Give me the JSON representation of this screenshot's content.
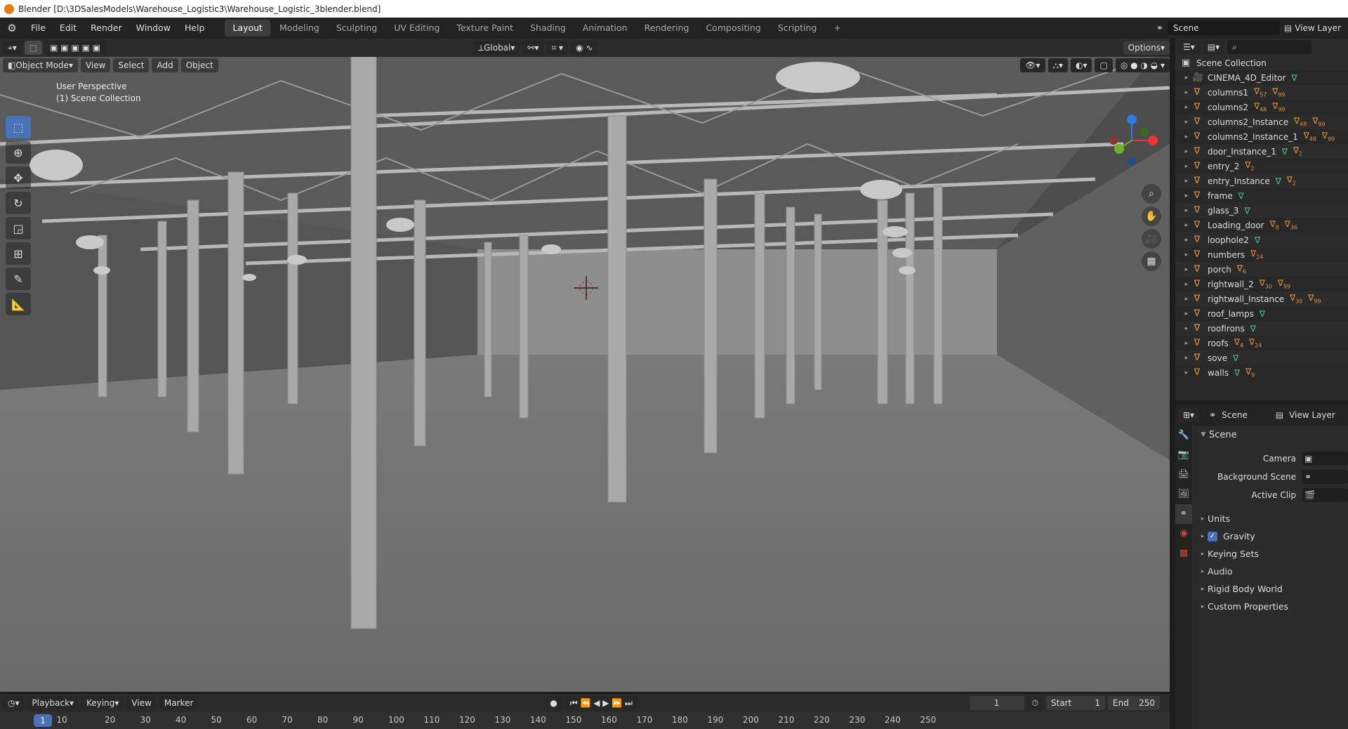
{
  "window": {
    "title": "Blender [D:\\3DSalesModels\\Warehouse_Logistic3\\Warehouse_Logistic_3blender.blend]"
  },
  "menu": [
    "File",
    "Edit",
    "Render",
    "Window",
    "Help"
  ],
  "workspaces": [
    {
      "label": "Layout",
      "active": true
    },
    {
      "label": "Modeling"
    },
    {
      "label": "Sculpting"
    },
    {
      "label": "UV Editing"
    },
    {
      "label": "Texture Paint"
    },
    {
      "label": "Shading"
    },
    {
      "label": "Animation"
    },
    {
      "label": "Rendering"
    },
    {
      "label": "Compositing"
    },
    {
      "label": "Scripting"
    }
  ],
  "top_right": {
    "scene": "Scene",
    "view_layer": "View Layer"
  },
  "viewport_header": {
    "mode": "Object Mode",
    "view": "View",
    "select": "Select",
    "add": "Add",
    "object": "Object",
    "orientation": "Global",
    "options": "Options"
  },
  "viewport": {
    "perspective": "User Perspective",
    "collection": "(1) Scene Collection"
  },
  "timeline": {
    "playback": "Playback",
    "keying": "Keying",
    "view": "View",
    "marker": "Marker",
    "current_frame": "1",
    "start_label": "Start",
    "start": "1",
    "end_label": "End",
    "end": "250"
  },
  "timeline_frames": [
    "1",
    "10",
    "20",
    "30",
    "40",
    "50",
    "60",
    "70",
    "80",
    "90",
    "100",
    "110",
    "120",
    "130",
    "140",
    "150",
    "160",
    "170",
    "180",
    "190",
    "200",
    "210",
    "220",
    "230",
    "240",
    "250"
  ],
  "outliner": {
    "root": "Scene Collection",
    "items": [
      {
        "name": "CINEMA_4D_Editor",
        "tags": [
          ""
        ]
      },
      {
        "name": "columns1",
        "tags": [
          "57",
          "99"
        ]
      },
      {
        "name": "columns2",
        "tags": [
          "48",
          "99"
        ]
      },
      {
        "name": "columns2_Instance",
        "tags": [
          "48",
          "99"
        ]
      },
      {
        "name": "columns2_Instance_1",
        "tags": [
          "48",
          "99"
        ]
      },
      {
        "name": "door_Instance_1",
        "tags": [
          "",
          "2"
        ]
      },
      {
        "name": "entry_2",
        "tags": [
          "2"
        ]
      },
      {
        "name": "entry_Instance",
        "tags": [
          "",
          "2"
        ]
      },
      {
        "name": "frame",
        "tags": [
          ""
        ]
      },
      {
        "name": "glass_3",
        "tags": [
          ""
        ]
      },
      {
        "name": "Loading_door",
        "tags": [
          "8",
          "36"
        ]
      },
      {
        "name": "loophole2",
        "tags": [
          ""
        ]
      },
      {
        "name": "numbers",
        "tags": [
          "24"
        ]
      },
      {
        "name": "porch",
        "tags": [
          "6"
        ]
      },
      {
        "name": "rightwall_2",
        "tags": [
          "30",
          "99"
        ]
      },
      {
        "name": "rightwall_Instance",
        "tags": [
          "30",
          "99"
        ]
      },
      {
        "name": "roof_lamps",
        "tags": [
          ""
        ]
      },
      {
        "name": "roofirons",
        "tags": [
          ""
        ]
      },
      {
        "name": "roofs",
        "tags": [
          "4",
          "24"
        ]
      },
      {
        "name": "sove",
        "tags": [
          ""
        ]
      },
      {
        "name": "walls",
        "tags": [
          "",
          "9"
        ]
      }
    ]
  },
  "properties": {
    "tabs": {
      "scene": "Scene",
      "view_layer": "View Layer"
    },
    "section": "Scene",
    "rows": [
      {
        "label": "Camera"
      },
      {
        "label": "Background Scene"
      },
      {
        "label": "Active Clip"
      }
    ],
    "panels": [
      {
        "label": "Units"
      },
      {
        "label": "Gravity",
        "checkbox": true
      },
      {
        "label": "Keying Sets"
      },
      {
        "label": "Audio"
      },
      {
        "label": "Rigid Body World"
      },
      {
        "label": "Custom Properties"
      }
    ]
  },
  "colors": {
    "accent": "#4a72b8",
    "orange": "#e87d0d",
    "object": "#e8913a",
    "mesh": "#49c088"
  }
}
